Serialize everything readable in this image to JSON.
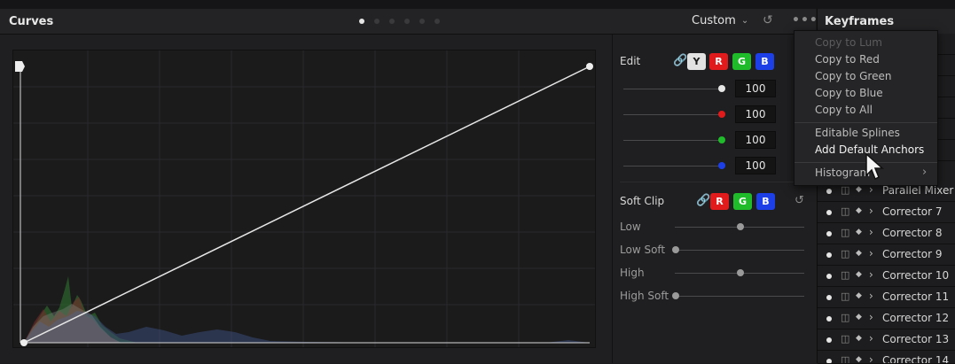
{
  "curves": {
    "title": "Curves",
    "mode": "Custom"
  },
  "edit": {
    "label": "Edit",
    "buttons": [
      "Y",
      "R",
      "G",
      "B"
    ],
    "values": [
      "100",
      "100",
      "100",
      "100"
    ]
  },
  "soft_clip": {
    "label": "Soft Clip",
    "buttons": [
      "R",
      "G",
      "B"
    ],
    "rows": [
      "Low",
      "Low Soft",
      "High",
      "High Soft"
    ]
  },
  "keyframes": {
    "title": "Keyframes",
    "rows": [
      "Parallel Mixer",
      "Corrector 7",
      "Corrector 8",
      "Corrector 9",
      "Corrector 10",
      "Corrector 11",
      "Corrector 12",
      "Corrector 13",
      "Corrector 14"
    ]
  },
  "menu": {
    "items": [
      "Copy to Lum",
      "Copy to Red",
      "Copy to Green",
      "Copy to Blue",
      "Copy to All",
      "Editable Splines",
      "Add Default Anchors",
      "Histogram"
    ]
  },
  "colors": {
    "accent_white": "#e6e6e6",
    "red": "#e11b1b",
    "green": "#1fbb2a",
    "blue": "#1d3fe8"
  }
}
